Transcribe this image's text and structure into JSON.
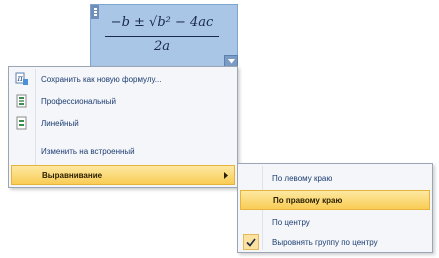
{
  "equation": {
    "numerator": "−b ± √b² − 4ac",
    "denominator": "2a"
  },
  "context_menu": {
    "items": [
      {
        "label": "Сохранить как новую формулу...",
        "icon": "save-formula-icon"
      },
      {
        "label": "Профессиональный",
        "icon": "professional-format-icon"
      },
      {
        "label": "Линейный",
        "icon": "linear-format-icon"
      },
      {
        "label": "Изменить на встроенный",
        "icon": ""
      },
      {
        "label": "Выравнивание",
        "icon": "",
        "has_submenu": true
      }
    ]
  },
  "submenu": {
    "items": [
      {
        "label": "По левому краю"
      },
      {
        "label": "По правому краю"
      },
      {
        "label": "По центру"
      },
      {
        "label": "Выровнять группу по центру",
        "checked": true
      }
    ]
  },
  "colors": {
    "equation_background": "#a9c6e6",
    "menu_background": "#f4f6f9",
    "highlight": "#f9cc55",
    "menu_text": "#1e3d72"
  }
}
